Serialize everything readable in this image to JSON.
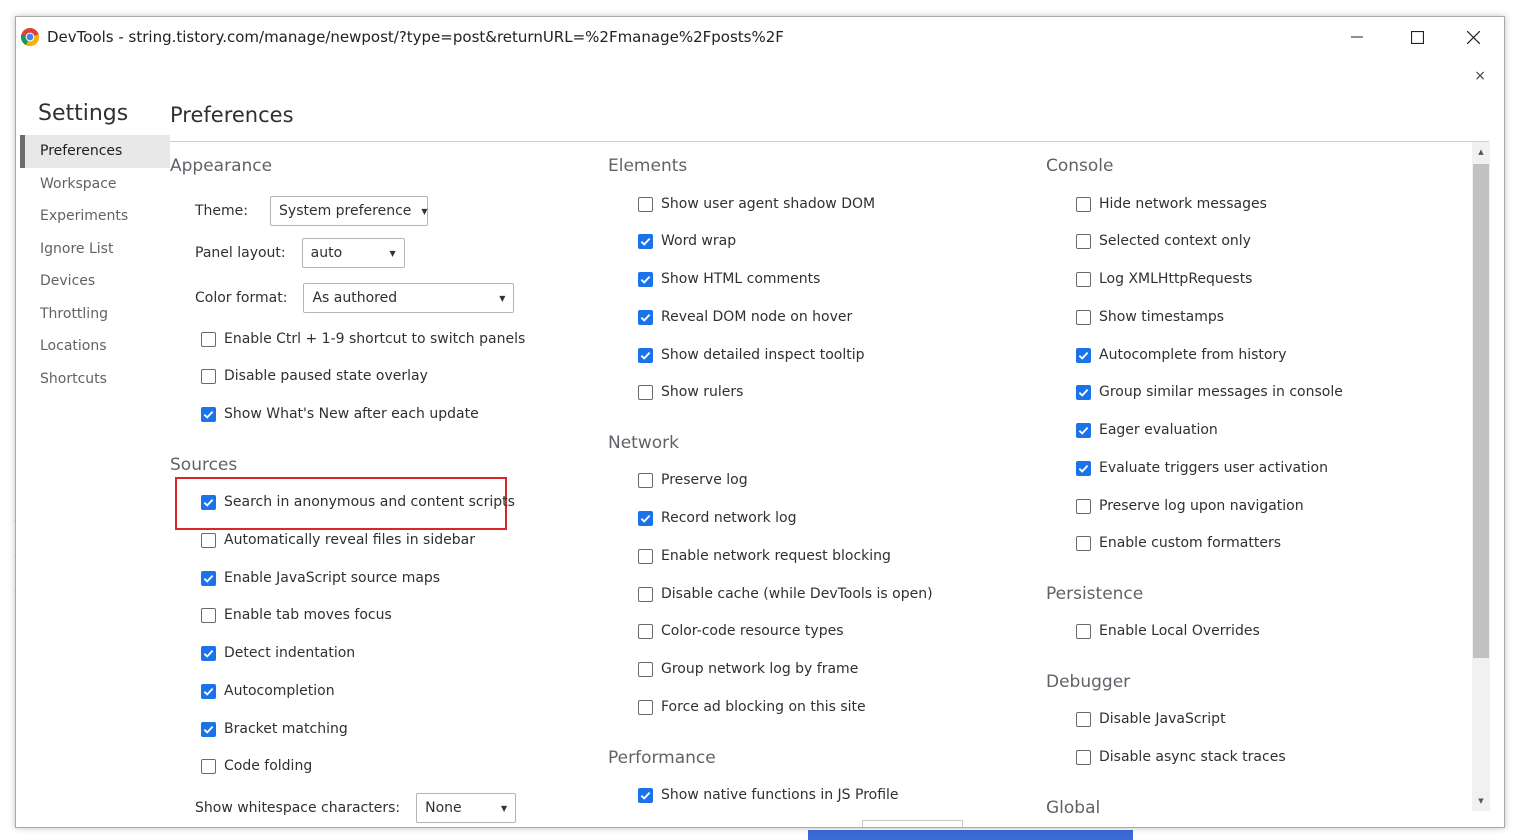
{
  "window": {
    "title": "DevTools - string.tistory.com/manage/newpost/?type=post&returnURL=%2Fmanage%2Fposts%2F",
    "close_symbol": "×"
  },
  "settings": {
    "title": "Settings",
    "nav": [
      {
        "label": "Preferences",
        "selected": true
      },
      {
        "label": "Workspace"
      },
      {
        "label": "Experiments"
      },
      {
        "label": "Ignore List"
      },
      {
        "label": "Devices"
      },
      {
        "label": "Throttling"
      },
      {
        "label": "Locations"
      },
      {
        "label": "Shortcuts"
      }
    ]
  },
  "preferences": {
    "title": "Preferences",
    "appearance": {
      "title": "Appearance",
      "theme_label": "Theme:",
      "theme_value": "System preference",
      "panel_layout_label": "Panel layout:",
      "panel_layout_value": "auto",
      "color_format_label": "Color format:",
      "color_format_value": "As authored",
      "checkboxes": [
        {
          "label": "Enable Ctrl + 1-9 shortcut to switch panels",
          "checked": false
        },
        {
          "label": "Disable paused state overlay",
          "checked": false
        },
        {
          "label": "Show What's New after each update",
          "checked": true
        }
      ]
    },
    "sources": {
      "title": "Sources",
      "checkboxes": [
        {
          "label": "Search in anonymous and content scripts",
          "checked": true
        },
        {
          "label": "Automatically reveal files in sidebar",
          "checked": false
        },
        {
          "label": "Enable JavaScript source maps",
          "checked": true
        },
        {
          "label": "Enable tab moves focus",
          "checked": false
        },
        {
          "label": "Detect indentation",
          "checked": true
        },
        {
          "label": "Autocompletion",
          "checked": true
        },
        {
          "label": "Bracket matching",
          "checked": true
        },
        {
          "label": "Code folding",
          "checked": false
        }
      ],
      "whitespace_label": "Show whitespace characters:",
      "whitespace_value": "None"
    },
    "elements": {
      "title": "Elements",
      "checkboxes": [
        {
          "label": "Show user agent shadow DOM",
          "checked": false
        },
        {
          "label": "Word wrap",
          "checked": true
        },
        {
          "label": "Show HTML comments",
          "checked": true
        },
        {
          "label": "Reveal DOM node on hover",
          "checked": true
        },
        {
          "label": "Show detailed inspect tooltip",
          "checked": true
        },
        {
          "label": "Show rulers",
          "checked": false
        }
      ]
    },
    "network": {
      "title": "Network",
      "checkboxes": [
        {
          "label": "Preserve log",
          "checked": false
        },
        {
          "label": "Record network log",
          "checked": true
        },
        {
          "label": "Enable network request blocking",
          "checked": false
        },
        {
          "label": "Disable cache (while DevTools is open)",
          "checked": false
        },
        {
          "label": "Color-code resource types",
          "checked": false
        },
        {
          "label": "Group network log by frame",
          "checked": false
        },
        {
          "label": "Force ad blocking on this site",
          "checked": false
        }
      ]
    },
    "performance": {
      "title": "Performance",
      "checkboxes": [
        {
          "label": "Show native functions in JS Profile",
          "checked": true
        }
      ]
    },
    "console": {
      "title": "Console",
      "checkboxes": [
        {
          "label": "Hide network messages",
          "checked": false
        },
        {
          "label": "Selected context only",
          "checked": false
        },
        {
          "label": "Log XMLHttpRequests",
          "checked": false
        },
        {
          "label": "Show timestamps",
          "checked": false
        },
        {
          "label": "Autocomplete from history",
          "checked": true
        },
        {
          "label": "Group similar messages in console",
          "checked": true
        },
        {
          "label": "Eager evaluation",
          "checked": true
        },
        {
          "label": "Evaluate triggers user activation",
          "checked": true
        },
        {
          "label": "Preserve log upon navigation",
          "checked": false
        },
        {
          "label": "Enable custom formatters",
          "checked": false
        }
      ]
    },
    "persistence": {
      "title": "Persistence",
      "checkboxes": [
        {
          "label": "Enable Local Overrides",
          "checked": false
        }
      ]
    },
    "debugger": {
      "title": "Debugger",
      "checkboxes": [
        {
          "label": "Disable JavaScript",
          "checked": false
        },
        {
          "label": "Disable async stack traces",
          "checked": false
        }
      ]
    },
    "global": {
      "title": "Global"
    }
  },
  "colors": {
    "accent": "#1a73e8",
    "highlight": "#d9262b"
  }
}
